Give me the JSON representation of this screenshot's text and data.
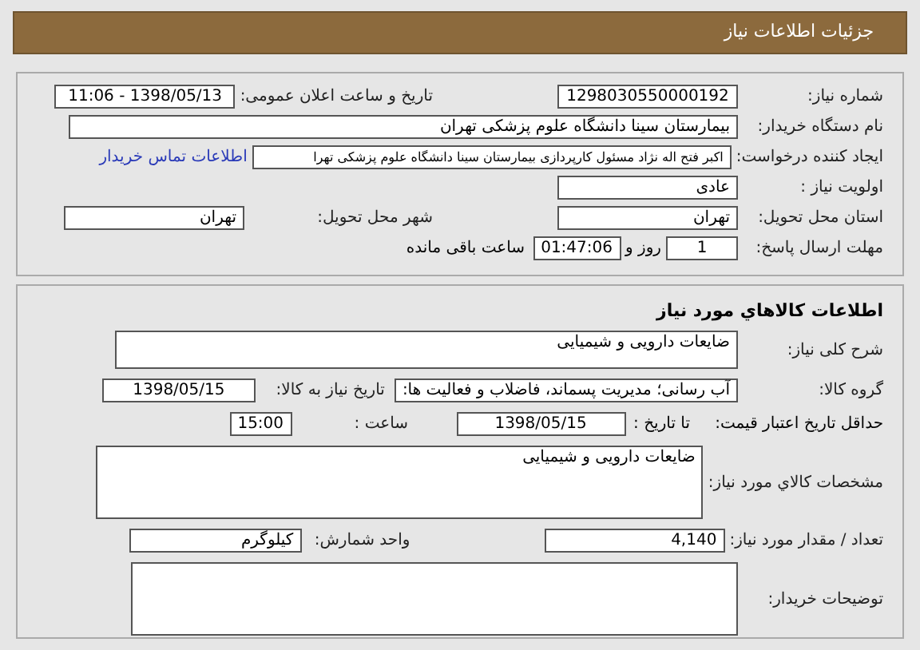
{
  "header": {
    "title": "جزئیات اطلاعات نیاز"
  },
  "request": {
    "need_number": {
      "label": "شماره نیاز:",
      "value": "1298030550000192"
    },
    "announce_date": {
      "label": "تاریخ و ساعت اعلان عمومی:",
      "value": "1398/05/13 - 11:06"
    },
    "buyer_org": {
      "label": "نام دستگاه خریدار:",
      "value": "بیمارستان سینا دانشگاه علوم پزشکی تهران"
    },
    "creator": {
      "label": "ایجاد کننده درخواست:",
      "value": "اکبر  فتح اله نژاد  مسئول کارپردازی  بیمارستان سینا دانشگاه علوم پزشکی تهرا",
      "link": "اطلاعات تماس خریدار"
    },
    "priority": {
      "label": "اولویت نیاز :",
      "value": "عادی"
    },
    "province": {
      "label": "استان محل تحویل:",
      "value": "تهران"
    },
    "city": {
      "label": "شهر محل تحویل:",
      "value": "تهران"
    },
    "deadline": {
      "label": "مهلت ارسال پاسخ:",
      "days": "1",
      "days_label": "روز و",
      "time": "01:47:06",
      "time_label": "ساعت باقی مانده"
    }
  },
  "goods": {
    "title": "اطلاعات کالاهاي مورد نياز",
    "summary": {
      "label": "شرح کلی نیاز:",
      "value": "ضایعات دارویی و شیمیایی"
    },
    "group": {
      "label": "گروه کالا:",
      "value": "آب رسانی؛ مدیریت پسماند، فاضلاب و فعالیت ها:"
    },
    "need_date": {
      "label": "تاریخ نیاز به کالا:",
      "value": "1398/05/15"
    },
    "validity": {
      "label": "حداقل تاریخ اعتبار قیمت:",
      "to_label": "تا تاریخ :",
      "date": "1398/05/15",
      "time_label": "ساعت :",
      "time": "15:00"
    },
    "specs": {
      "label": "مشخصات کالاي مورد نياز:",
      "value": "ضایعات دارویی و شیمیایی"
    },
    "quantity": {
      "label": "تعداد / مقدار مورد نیاز:",
      "value": "4,140"
    },
    "unit": {
      "label": "واحد شمارش:",
      "value": "کیلوگرم"
    },
    "notes": {
      "label": "توضیحات خریدار:"
    }
  }
}
